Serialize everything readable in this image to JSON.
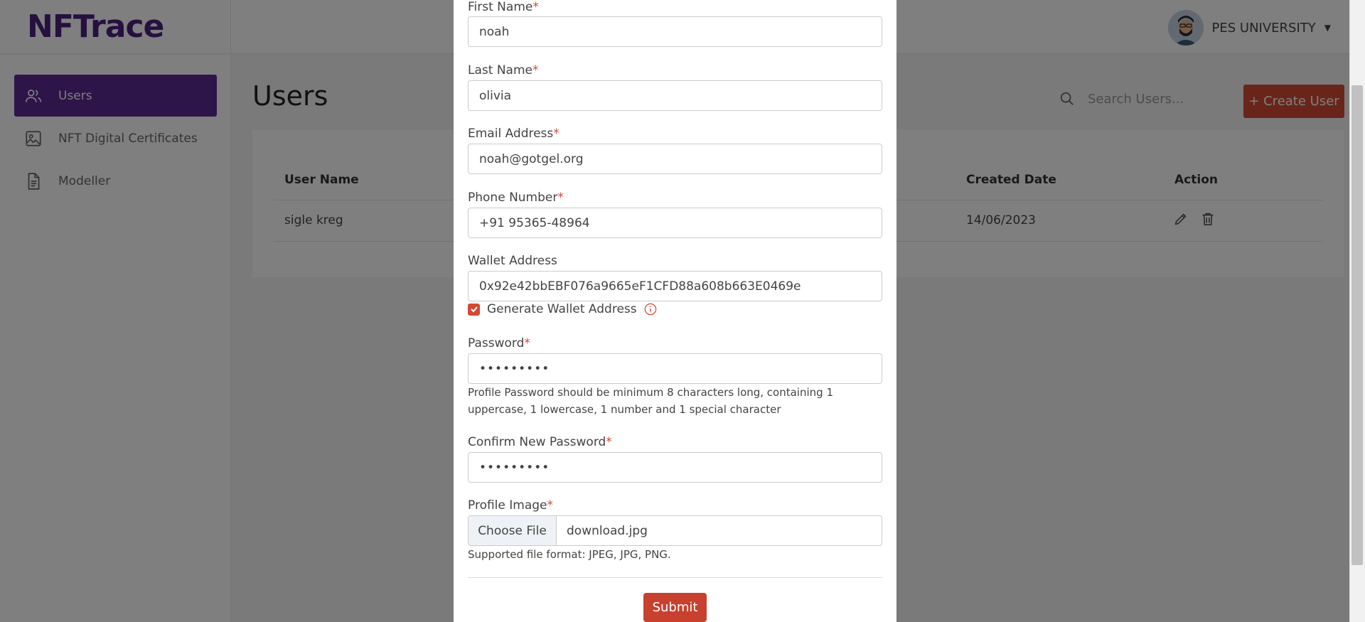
{
  "app": {
    "logo": "NFTrace",
    "user_name": "PES UNIVERSITY"
  },
  "sidebar": {
    "items": [
      {
        "label": "Users",
        "icon": "users-icon",
        "active": true
      },
      {
        "label": "NFT Digital Certificates",
        "icon": "image-icon",
        "active": false
      },
      {
        "label": "Modeller",
        "icon": "document-icon",
        "active": false
      }
    ]
  },
  "main": {
    "title": "Users",
    "search_placeholder": "Search Users...",
    "create_button": "+ Create User",
    "table": {
      "headers": [
        "User Name",
        "Created Date",
        "Action"
      ],
      "rows": [
        {
          "user_name": "sigle kreg",
          "created_date": "14/06/2023"
        }
      ]
    }
  },
  "modal": {
    "first_name": {
      "label": "First Name",
      "value": "noah"
    },
    "last_name": {
      "label": "Last Name",
      "value": "olivia"
    },
    "email": {
      "label": "Email Address",
      "value": "noah@gotgel.org"
    },
    "phone": {
      "label": "Phone Number",
      "value": "+91 95365-48964"
    },
    "wallet": {
      "label": "Wallet Address",
      "value": "0x92e42bbEBF076a9665eF1CFD88a608b663E0469e"
    },
    "generate_wallet": {
      "label": "Generate Wallet Address",
      "checked": true
    },
    "password": {
      "label": "Password",
      "value": "•••••••••"
    },
    "password_help": "Profile Password should be minimum 8 characters long, containing 1 uppercase, 1 lowercase, 1 number and 1 special character",
    "confirm_password": {
      "label": "Confirm New Password",
      "value": "•••••••••"
    },
    "profile_image": {
      "label": "Profile Image",
      "button": "Choose File",
      "file_name": "download.jpg"
    },
    "file_help": "Supported file format: JPEG, JPG, PNG.",
    "required_mark": "*",
    "submit": "Submit"
  },
  "colors": {
    "brand": "#5b2a93",
    "accent": "#d24a35"
  }
}
